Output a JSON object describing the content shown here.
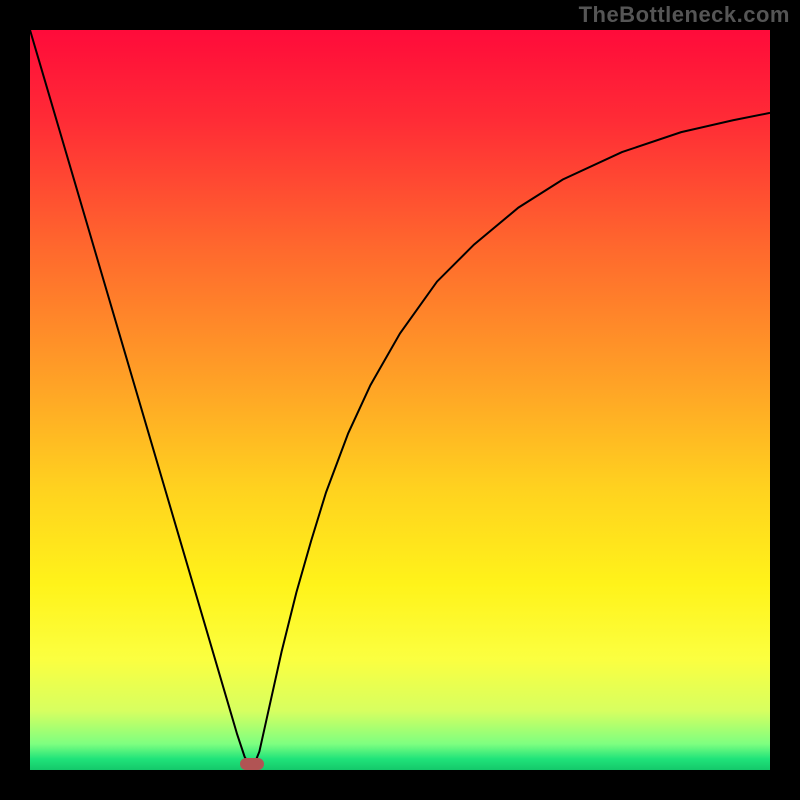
{
  "watermark": "TheBottleneck.com",
  "chart_data": {
    "type": "line",
    "title": "",
    "xlabel": "",
    "ylabel": "",
    "xlim": [
      0,
      100
    ],
    "ylim": [
      0,
      100
    ],
    "gradient_stops": [
      {
        "offset": 0.0,
        "color": "#ff0b3a"
      },
      {
        "offset": 0.12,
        "color": "#ff2b36"
      },
      {
        "offset": 0.3,
        "color": "#ff6a2d"
      },
      {
        "offset": 0.48,
        "color": "#ffa326"
      },
      {
        "offset": 0.62,
        "color": "#ffd21f"
      },
      {
        "offset": 0.75,
        "color": "#fff31a"
      },
      {
        "offset": 0.85,
        "color": "#fbff40"
      },
      {
        "offset": 0.92,
        "color": "#d7ff60"
      },
      {
        "offset": 0.965,
        "color": "#7dff80"
      },
      {
        "offset": 0.985,
        "color": "#20e37a"
      },
      {
        "offset": 1.0,
        "color": "#14c86a"
      }
    ],
    "series": [
      {
        "name": "bottleneck-curve",
        "x": [
          0,
          2,
          4,
          6,
          8,
          10,
          12,
          14,
          16,
          18,
          20,
          22,
          24,
          26,
          27,
          28,
          29,
          30,
          31,
          32,
          34,
          36,
          38,
          40,
          43,
          46,
          50,
          55,
          60,
          66,
          72,
          80,
          88,
          95,
          100
        ],
        "y": [
          100,
          93.2,
          86.4,
          79.6,
          72.8,
          66.0,
          59.2,
          52.4,
          45.6,
          38.8,
          32.0,
          25.2,
          18.4,
          11.6,
          8.2,
          4.8,
          1.8,
          0.0,
          2.5,
          7.0,
          16.0,
          24.0,
          31.0,
          37.5,
          45.5,
          52.0,
          59.0,
          66.0,
          71.0,
          76.0,
          79.8,
          83.5,
          86.2,
          87.8,
          88.8
        ]
      }
    ],
    "minimum_marker": {
      "x": 30,
      "y": 0,
      "w": 3.2,
      "h": 1.6,
      "color": "#b15454"
    }
  }
}
